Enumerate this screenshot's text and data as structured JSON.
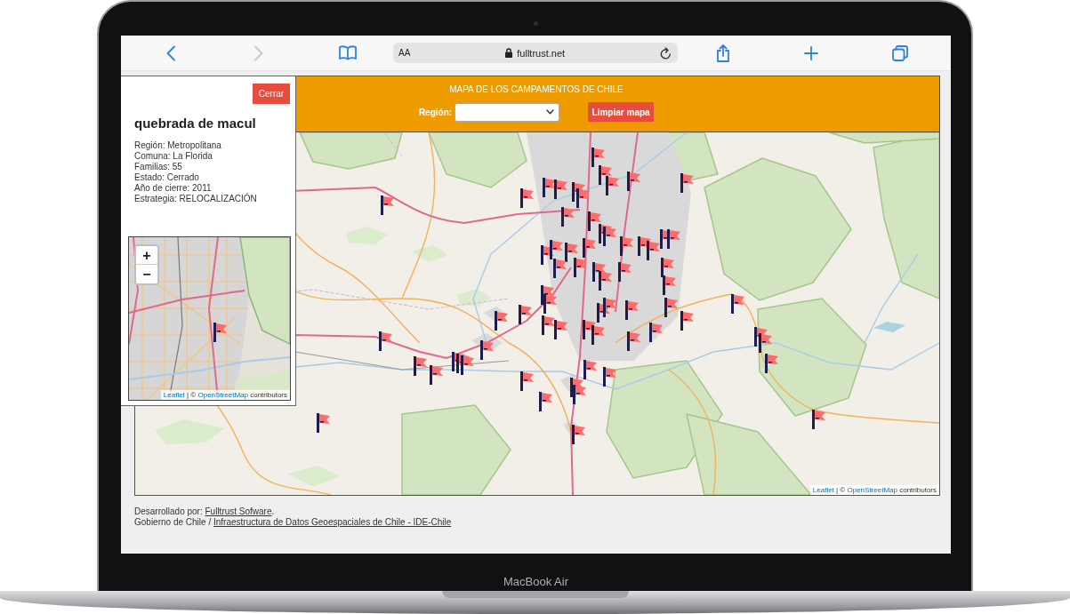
{
  "device": {
    "label": "MacBook Air"
  },
  "browser": {
    "buttons": [
      {
        "kind": "back",
        "disabled": false
      },
      {
        "kind": "forward",
        "disabled": true
      },
      {
        "kind": "bookmarks",
        "disabled": false
      }
    ],
    "address_bar": {
      "reader_button": "AA",
      "url": "fulltrust.net"
    },
    "actions": [
      {
        "kind": "share"
      },
      {
        "kind": "new_tab"
      },
      {
        "kind": "tabs"
      }
    ]
  },
  "map": {
    "header": {
      "title": "MAPA DE LOS CAMPAMENTOS DE CHILE",
      "region_label": "Región:",
      "clear_button": "Limpiar mapa"
    },
    "attribution": {
      "link_1": "Leaflet",
      "text_1": "| ©",
      "link_2": "OpenStreetMap",
      "text_2": "contributors"
    }
  },
  "info_panel": {
    "close_button": "Cerrar",
    "title": "quebrada de macul",
    "details": [
      "Región: Metropolitana",
      "Comuna: La Florida",
      "Familias: 55",
      "Estado: Cerrado",
      "Año de cierre: 2011",
      "Estrategia: RELOCALIZACIÓN"
    ],
    "mini_map": {
      "zoom_in": "+",
      "zoom_out": "−",
      "attribution": {
        "link_1": "Leaflet",
        "text_1": "| ©",
        "link_2": "OpenStreetMap",
        "text_2": "contributors"
      }
    }
  },
  "footer": [
    {
      "prefix": "Desarrollado por:",
      "link": "Fulltrust Sofware",
      "suffix": "."
    },
    {
      "prefix": "Gobierno de Chile /",
      "link": "Infraestructura de Datos Geoespaciales de Chile - IDE-Chile"
    }
  ]
}
